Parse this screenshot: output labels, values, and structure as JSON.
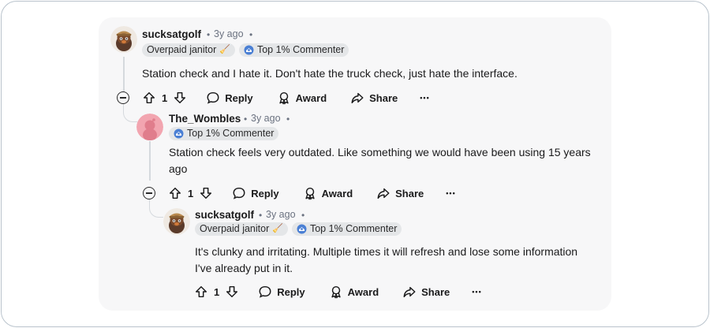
{
  "comments": [
    {
      "username": "sucksatgolf",
      "age": "3y ago",
      "flairs": [
        {
          "label": "Overpaid janitor",
          "emoji": "🧹"
        },
        {
          "label": "Top 1% Commenter"
        }
      ],
      "body": "Station check and I hate it. Don't hate the truck check, just hate the interface.",
      "votes": "1",
      "actions": {
        "reply": "Reply",
        "award": "Award",
        "share": "Share"
      }
    },
    {
      "username": "The_Wombles",
      "age": "3y ago",
      "flairs": [
        {
          "label": "Top 1% Commenter"
        }
      ],
      "body": "Station check feels very outdated. Like something we would have been using 15 years ago",
      "votes": "1",
      "actions": {
        "reply": "Reply",
        "award": "Award",
        "share": "Share"
      }
    },
    {
      "username": "sucksatgolf",
      "age": "3y ago",
      "flairs": [
        {
          "label": "Overpaid janitor",
          "emoji": "🧹"
        },
        {
          "label": "Top 1% Commenter"
        }
      ],
      "body": "It's clunky and irritating. Multiple times it will refresh and lose some information I've already put in it.",
      "votes": "1",
      "actions": {
        "reply": "Reply",
        "award": "Award",
        "share": "Share"
      }
    }
  ],
  "separator": "•",
  "more_label": "•••",
  "colors": {
    "accent_blue": "#4a7fd4",
    "avatar_pink": "#f2a5b0"
  }
}
